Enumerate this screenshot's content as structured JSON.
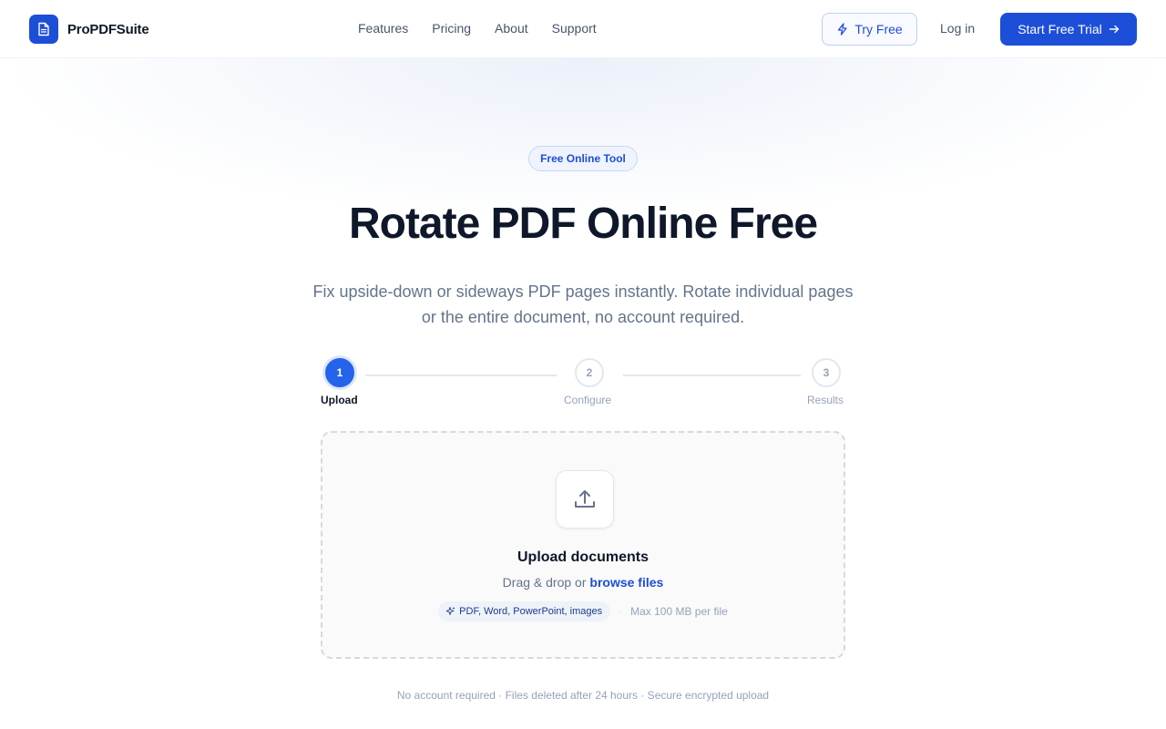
{
  "header": {
    "brand_name": "ProPDFSuite",
    "nav": [
      "Features",
      "Pricing",
      "About",
      "Support"
    ],
    "try_free_label": "Try Free",
    "login_label": "Log in",
    "trial_label": "Start Free Trial"
  },
  "hero": {
    "badge": "Free Online Tool",
    "title": "Rotate PDF Online Free",
    "subtitle": "Fix upside-down or sideways PDF pages instantly. Rotate individual pages or the entire document, no account required."
  },
  "stepper": {
    "current_step": 1,
    "steps": [
      {
        "number": "1",
        "label": "Upload"
      },
      {
        "number": "2",
        "label": "Configure"
      },
      {
        "number": "3",
        "label": "Results"
      }
    ]
  },
  "upload": {
    "title": "Upload documents",
    "sub_prefix": "Drag & drop or",
    "browse_label": "browse files",
    "formats": "PDF, Word, PowerPoint, images",
    "separator": "·",
    "max_size": "Max 100 MB per file"
  },
  "footer_note": "No account required · Files deleted after 24 hours · Secure encrypted upload",
  "colors": {
    "primary": "#1d4ed8",
    "step_active": "#2563eb",
    "text_dark": "#0f172a",
    "text_muted": "#64748b"
  },
  "icons": {
    "brand": "document-icon",
    "try_free": "lightning-icon",
    "trial": "arrow-right-icon",
    "upload": "upload-icon",
    "formats": "sparkle-icon"
  }
}
